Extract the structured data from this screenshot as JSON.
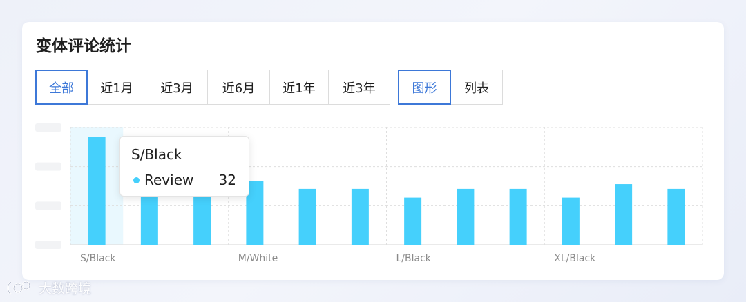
{
  "title": "变体评论统计",
  "range_tabs": [
    {
      "label": "全部",
      "active": true
    },
    {
      "label": "近1月",
      "active": false
    },
    {
      "label": "近3月",
      "active": false
    },
    {
      "label": "近6月",
      "active": false
    },
    {
      "label": "近1年",
      "active": false
    },
    {
      "label": "近3年",
      "active": false
    }
  ],
  "view_tabs": [
    {
      "label": "图形",
      "active": true
    },
    {
      "label": "列表",
      "active": false
    }
  ],
  "colors": {
    "bar": "#45d0fc",
    "accent": "#3d78d8",
    "highlight": "#e9f8fe"
  },
  "chart_data": {
    "type": "bar",
    "categories": [
      "S/Black",
      "",
      "",
      "M/White",
      "",
      "",
      "L/Black",
      "",
      "",
      "XL/Black",
      "",
      ""
    ],
    "series": [
      {
        "name": "Review",
        "values": [
          32,
          15,
          15,
          19,
          16.6,
          16.6,
          14,
          16.6,
          16.6,
          14,
          18,
          16.6
        ]
      }
    ],
    "ylim": [
      0,
      35
    ],
    "y_ticks": [
      0,
      11.6,
      23.2,
      34.8
    ],
    "grid": true,
    "highlighted_index": 0
  },
  "tooltip": {
    "title": "S/Black",
    "label": "Review",
    "value": "32"
  },
  "watermark": {
    "text": "大数跨境"
  }
}
